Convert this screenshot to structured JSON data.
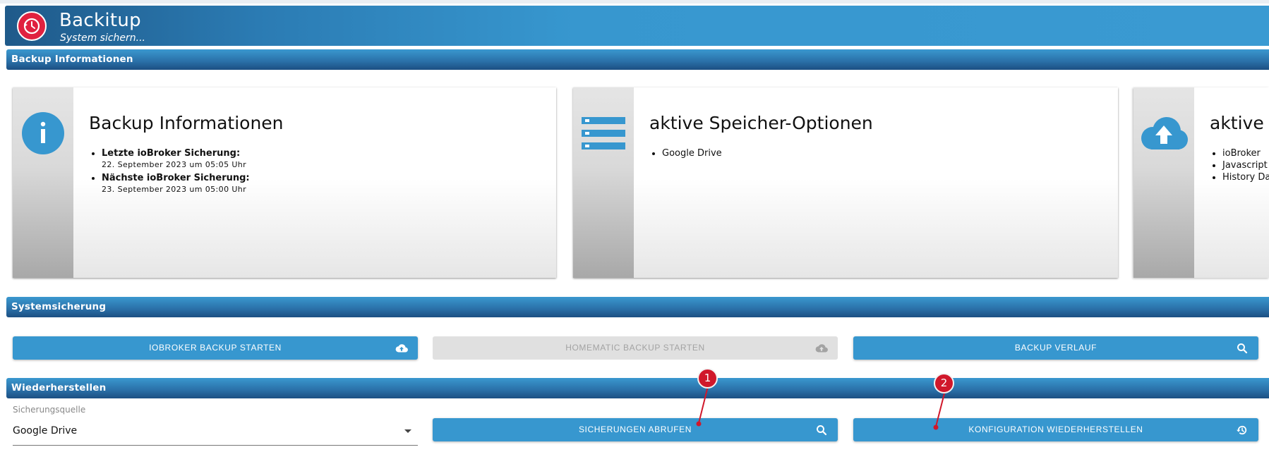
{
  "header": {
    "title": "Backitup",
    "subtitle": "System sichern..."
  },
  "sections": {
    "backup_info": "Backup Informationen",
    "system_backup": "Systemsicherung",
    "restore": "Wiederherstellen"
  },
  "cards": {
    "info": {
      "title": "Backup Informationen",
      "last_label": "Letzte ioBroker Sicherung:",
      "last_value": "22. September 2023 um 05:05 Uhr",
      "next_label": "Nächste ioBroker Sicherung:",
      "next_value": "23. September 2023 um 05:00 Uhr",
      "icon": "info-icon"
    },
    "storage": {
      "title": "aktive Speicher-Optionen",
      "items": [
        "Google Drive"
      ],
      "icon": "storage-list-icon"
    },
    "backups": {
      "title": "aktive B",
      "items": [
        "ioBroker",
        "Javascript",
        "History Dat"
      ],
      "icon": "cloud-upload-icon"
    }
  },
  "buttons": {
    "iobroker_backup": "iobroker backup starten",
    "homematic_backup": "homematic backup starten",
    "backup_history": "backup verlauf",
    "fetch_backups": "sicherungen abrufen",
    "restore_config": "konfiguration wiederherstellen"
  },
  "restore": {
    "source_label": "Sicherungsquelle",
    "source_value": "Google Drive"
  },
  "markers": [
    "1",
    "2"
  ],
  "colors": {
    "accent": "#3797cf",
    "logo": "#e0213f",
    "marker": "#d0182b"
  }
}
